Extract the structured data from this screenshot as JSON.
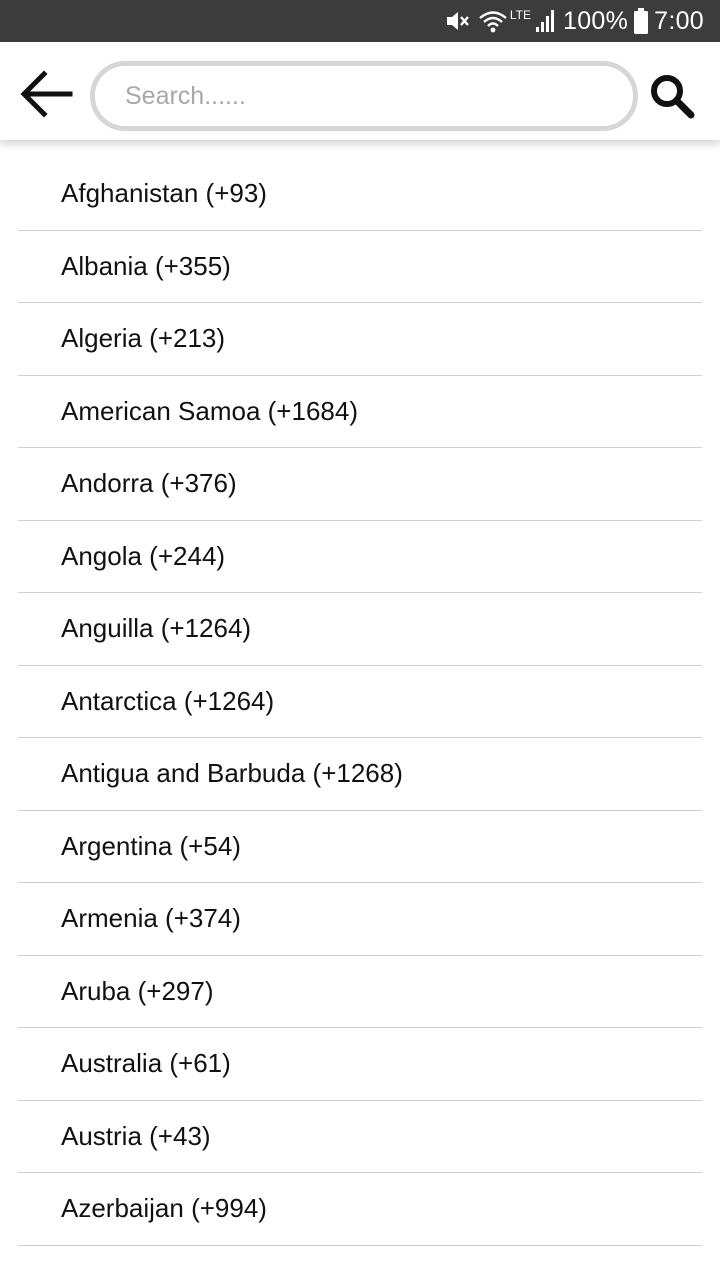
{
  "status_bar": {
    "battery_percent": "100%",
    "time": "7:00",
    "network_type": "LTE",
    "icons": [
      "mute-icon",
      "wifi-icon",
      "signal-icon",
      "battery-icon"
    ]
  },
  "header": {
    "search": {
      "placeholder": "Search......",
      "value": ""
    },
    "icons": [
      "back-arrow-icon",
      "search-icon"
    ]
  },
  "countries": [
    "Afghanistan (+93)",
    "Albania (+355)",
    "Algeria (+213)",
    "American Samoa (+1684)",
    "Andorra (+376)",
    "Angola (+244)",
    "Anguilla (+1264)",
    "Antarctica (+1264)",
    "Antigua and Barbuda (+1268)",
    "Argentina (+54)",
    "Armenia (+374)",
    "Aruba (+297)",
    "Australia (+61)",
    "Austria (+43)",
    "Azerbaijan (+994)"
  ],
  "colors": {
    "status_bar_bg": "#3c3c3c",
    "search_border": "#d6d6d6",
    "divider": "#cfcfcf",
    "text": "#111111"
  }
}
